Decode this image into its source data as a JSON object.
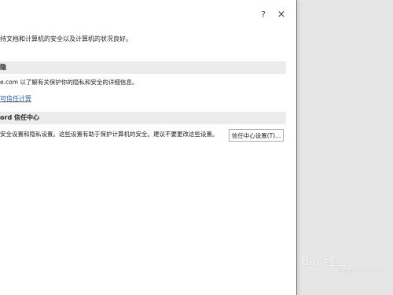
{
  "titlebar": {
    "help_label": "?",
    "close_label": "×"
  },
  "intro_text": "持文档和计算机的安全以及计算机的状况良好。",
  "privacy_section": {
    "header": "隐",
    "description": "e.com  以了解有关保护你的隐私和安全的详细信息。",
    "link_label": "可信任计算"
  },
  "trust_center_section": {
    "header": "ord 信任中心",
    "description": "安全设置和隐私设置。这些设置有助于保护计算机的安全。建议不要更改这些设置。",
    "button_label": "信任中心设置(T)..."
  },
  "watermark": {
    "text": "Bai 经验",
    "subtext": "jingyan.baidu.com"
  }
}
